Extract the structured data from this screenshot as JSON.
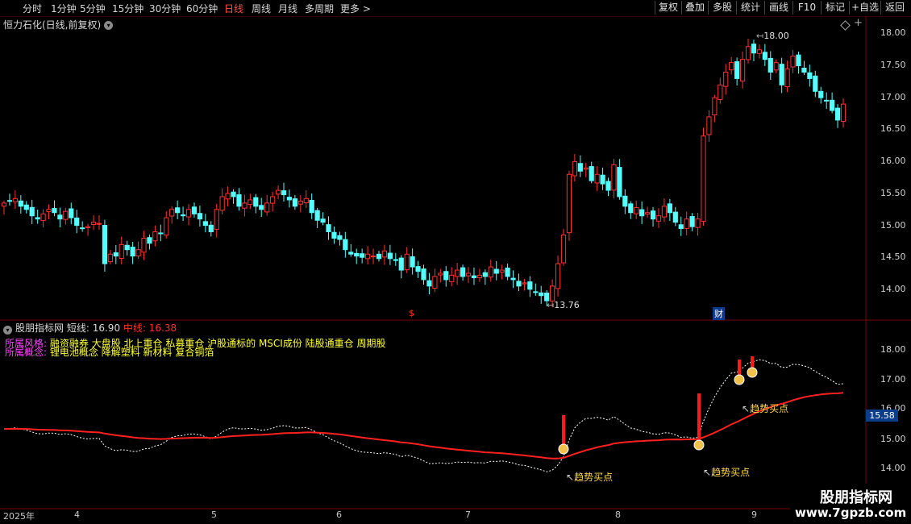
{
  "toolbar": {
    "periods": [
      "分时",
      "1分钟",
      "5分钟",
      "15分钟",
      "30分钟",
      "60分钟",
      "日线",
      "周线",
      "月线",
      "多周期",
      "更多 >"
    ],
    "active_period": "日线",
    "tools": [
      "复权",
      "叠加",
      "多股",
      "统计",
      "画线",
      "F10",
      "标记",
      "+自选",
      "返回"
    ]
  },
  "main_chart": {
    "title": "恒力石化(日线,前复权)",
    "high_label": "18.00",
    "low_label": "13.76",
    "marker_s": "$",
    "marker_cai": "财",
    "y_ticks": [
      "18.00",
      "17.50",
      "17.00",
      "16.50",
      "16.00",
      "15.50",
      "15.00",
      "14.50",
      "14.00"
    ]
  },
  "indicator": {
    "name": "股朋指标网",
    "short_label": "短线:",
    "short_value": "16.90",
    "mid_label": "中线:",
    "mid_value": "16.38",
    "style_label": "所属风格:",
    "style_text": "融资融券 大盘股 北上重仓 私募重仓 沪股通标的 MSCI成份 陆股通重仓 周期股",
    "concept_label": "所属概念:",
    "concept_text": "锂电池概念 降解塑料 新材料 复合铜箔",
    "buy_labels": [
      "趋势买点",
      "趋势买点",
      "趋势买点"
    ],
    "y_ticks": [
      "18.00",
      "17.00",
      "16.00",
      "15.00",
      "14.00"
    ],
    "current_value": "15.58"
  },
  "xaxis": {
    "labels": [
      "2025年",
      "4",
      "5",
      "6",
      "7",
      "8",
      "9"
    ]
  },
  "watermark": {
    "line1": "股朋指标网",
    "line2": "www.7gpzb.com"
  },
  "colors": {
    "up": "#ff3232",
    "down": "#54ffff",
    "mid_line": "#ff2020",
    "short_line": "#ffffff"
  },
  "chart_data": {
    "type": "candlestick",
    "y_range": [
      13.6,
      18.2
    ],
    "high": 18.0,
    "low": 13.76,
    "closes": [
      15.35,
      15.38,
      15.42,
      15.3,
      15.25,
      15.15,
      15.1,
      15.18,
      15.25,
      15.2,
      15.1,
      15.22,
      15.12,
      15.0,
      14.95,
      14.98,
      15.05,
      15.03,
      14.4,
      14.55,
      14.52,
      14.7,
      14.62,
      14.52,
      14.62,
      14.8,
      14.72,
      14.9,
      14.88,
      15.12,
      15.25,
      15.2,
      15.15,
      15.25,
      15.18,
      15.1,
      15.0,
      14.9,
      15.25,
      15.45,
      15.5,
      15.45,
      15.3,
      15.35,
      15.4,
      15.3,
      15.25,
      15.35,
      15.45,
      15.55,
      15.48,
      15.4,
      15.3,
      15.38,
      15.42,
      15.2,
      15.08,
      15.05,
      14.9,
      14.8,
      14.78,
      14.62,
      14.55,
      14.52,
      14.5,
      14.55,
      14.52,
      14.48,
      14.6,
      14.48,
      14.45,
      14.3,
      14.55,
      14.35,
      14.28,
      14.15,
      14.05,
      14.2,
      14.25,
      14.15,
      14.22,
      14.3,
      14.2,
      14.25,
      14.18,
      14.22,
      14.2,
      14.35,
      14.25,
      14.3,
      14.2,
      14.15,
      14.05,
      14.1,
      14.0,
      13.95,
      13.9,
      13.82,
      14.05,
      14.4,
      14.85,
      15.8,
      16.0,
      15.85,
      15.9,
      15.7,
      15.8,
      15.65,
      15.55,
      15.95,
      15.45,
      15.3,
      15.2,
      15.28,
      15.15,
      15.2,
      15.1,
      15.15,
      15.3,
      15.2,
      15.05,
      14.95,
      15.1,
      14.98,
      15.1,
      16.4,
      16.7,
      17.0,
      17.2,
      17.4,
      17.55,
      17.3,
      17.6,
      17.8,
      17.7,
      17.75,
      17.6,
      17.4,
      17.55,
      17.2,
      17.45,
      17.65,
      17.5,
      17.4,
      17.3,
      17.1,
      17.0,
      16.95,
      16.8,
      16.65,
      16.9
    ]
  }
}
